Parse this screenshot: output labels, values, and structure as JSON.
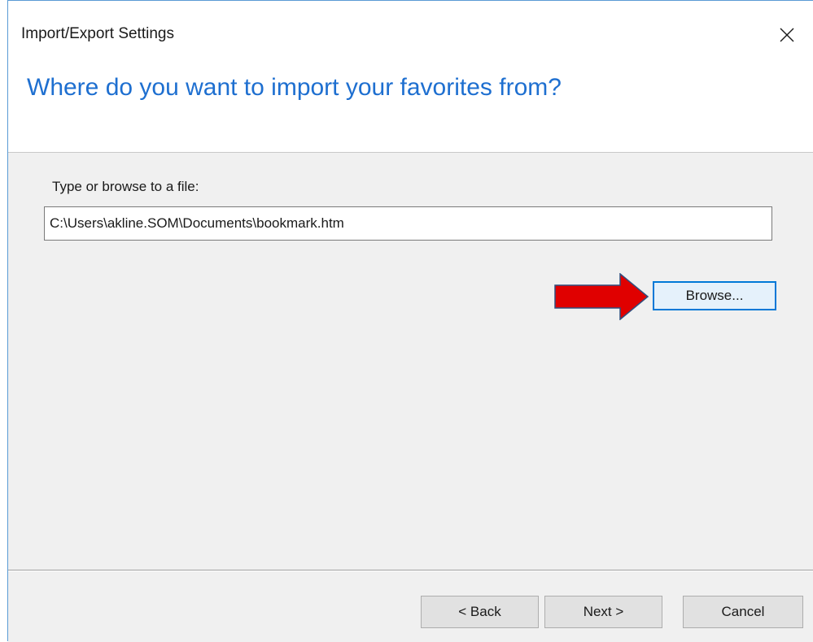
{
  "window": {
    "title": "Import/Export Settings",
    "close_icon": "close-icon"
  },
  "header": {
    "heading": "Where do you want to import your favorites from?"
  },
  "form": {
    "file_label": "Type or browse to a file:",
    "file_path_value": "C:\\Users\\akline.SOM\\Documents\\bookmark.htm",
    "browse_label": "Browse..."
  },
  "annotation": {
    "arrow_icon": "red-arrow-icon",
    "arrow_color": "#e00000"
  },
  "footer": {
    "back_label": "< Back",
    "next_label": "Next >",
    "cancel_label": "Cancel"
  },
  "colors": {
    "heading": "#1e6fd0",
    "accent_border": "#0078d7",
    "panel_bg": "#f0f0f0"
  }
}
